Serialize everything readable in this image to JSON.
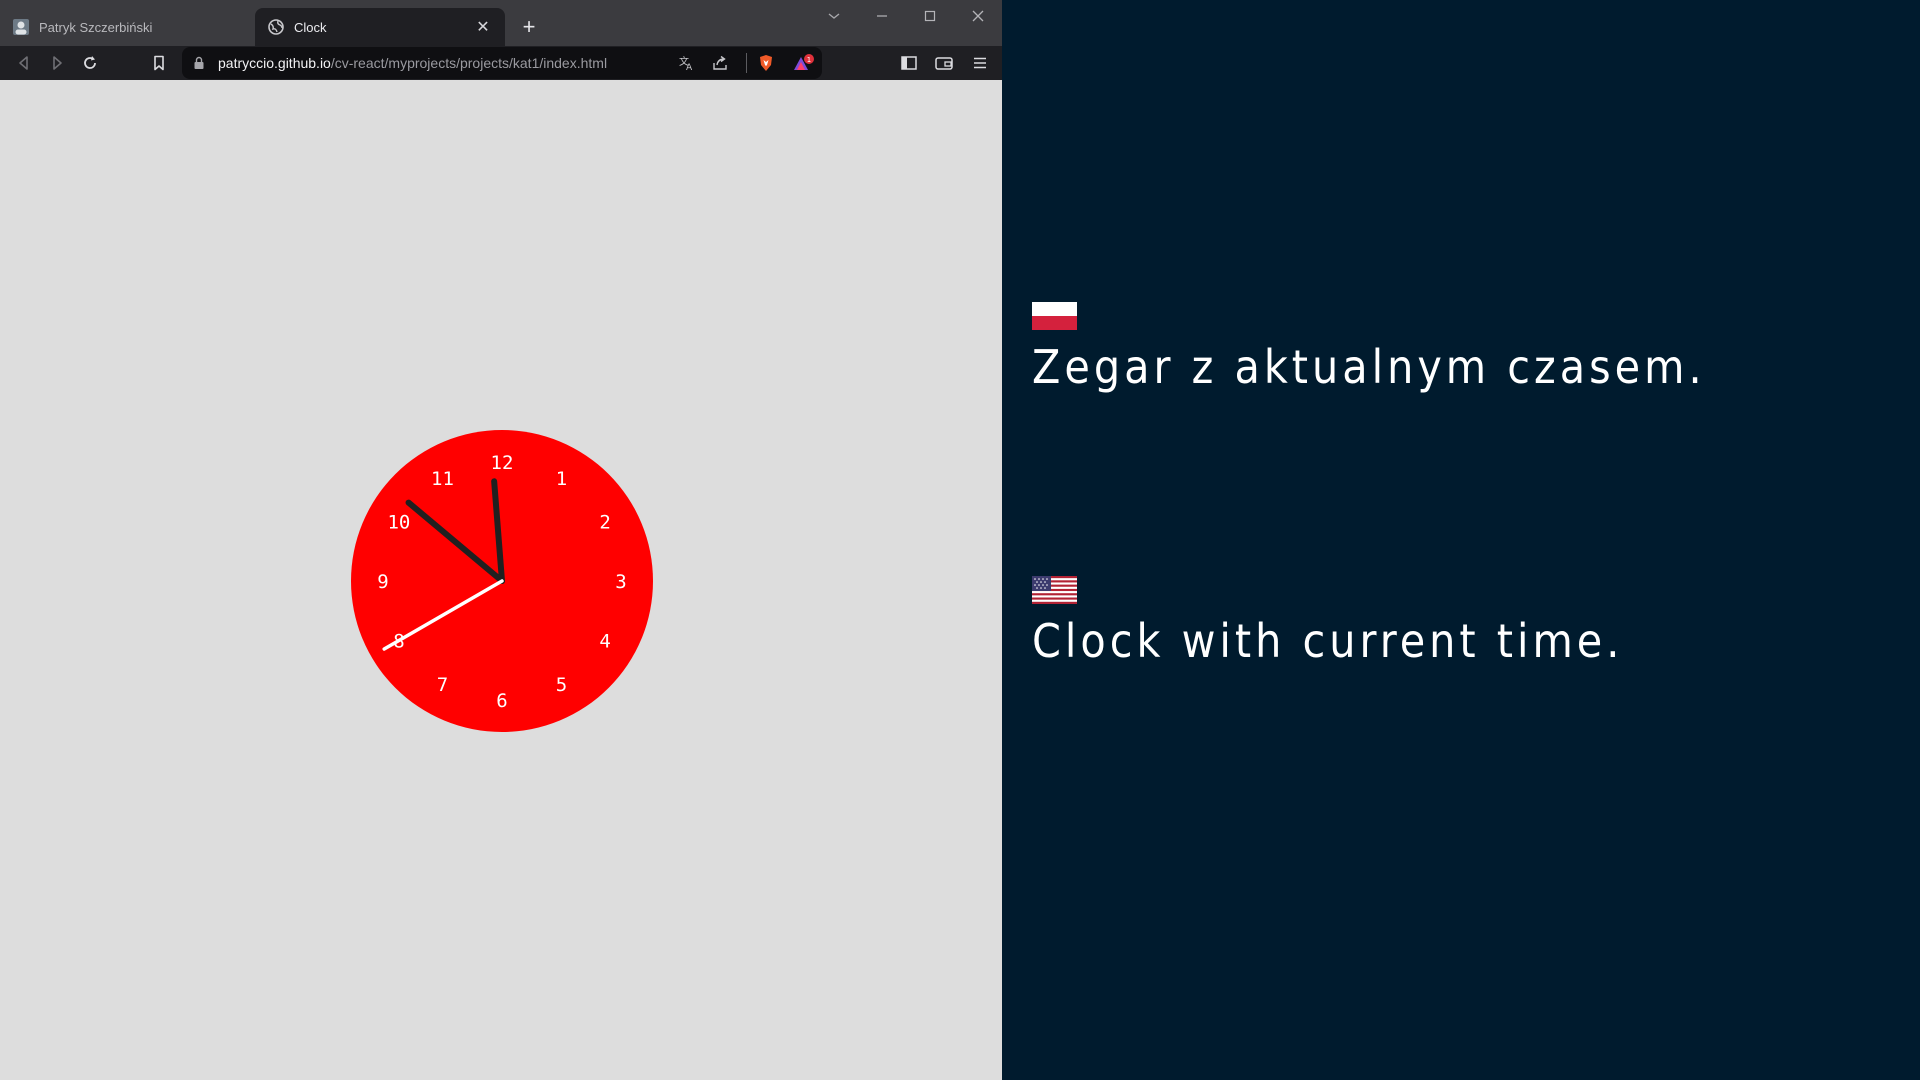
{
  "browser": {
    "tabs": [
      {
        "title": "Patryk Szczerbiński",
        "favicon": "profile-favicon",
        "active": false
      },
      {
        "title": "Clock",
        "favicon": "globe-favicon",
        "active": true
      }
    ],
    "new_tab_label": "+",
    "address": {
      "host": "patryccio.github.io",
      "path": "/cv-react/myprojects/projects/kat1/index.html"
    },
    "notification_count": "1"
  },
  "clock": {
    "numbers": [
      "12",
      "1",
      "2",
      "3",
      "4",
      "5",
      "6",
      "7",
      "8",
      "9",
      "10",
      "11"
    ],
    "face_color": "#ff0000",
    "hand_color": "#202020",
    "second_hand_color": "#ffffff",
    "time": {
      "hour": 11,
      "minute": 51,
      "second": 40
    }
  },
  "panel": {
    "pl_text": "Zegar z aktualnym czasem.",
    "en_text": "Clock with current time."
  },
  "colors": {
    "page_bg": "#dddddd",
    "panel_bg": "#001b2e",
    "chrome_dark": "#1f1f23",
    "accent": "#f05a28"
  }
}
